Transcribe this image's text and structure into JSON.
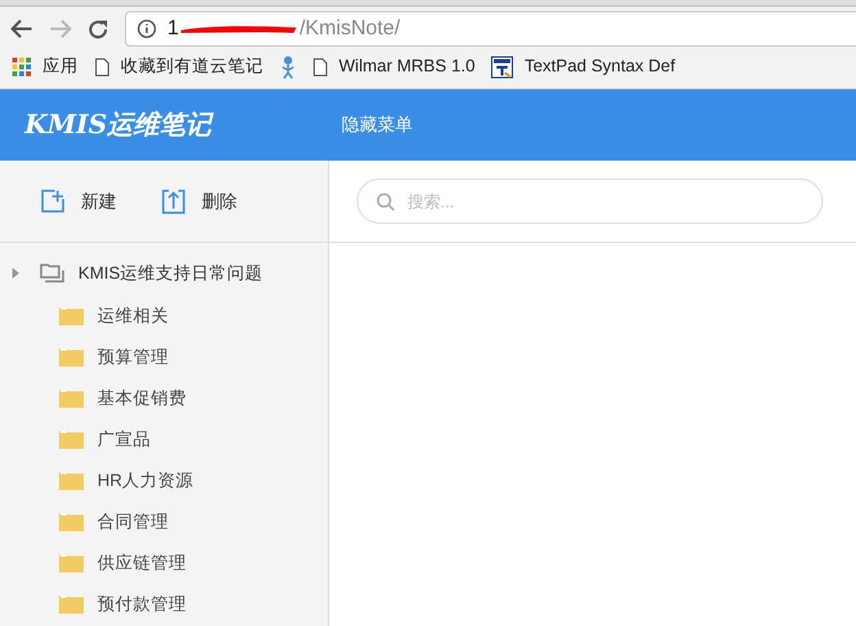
{
  "browser": {
    "url_start": "1",
    "url_rest": "/KmisNote/",
    "bookmarks": [
      {
        "kind": "apps",
        "label": "应用"
      },
      {
        "kind": "page",
        "label": "收藏到有道云笔记"
      },
      {
        "kind": "figure"
      },
      {
        "kind": "page",
        "label": "Wilmar MRBS 1.0"
      },
      {
        "kind": "textpad",
        "label": "TextPad Syntax Def"
      }
    ]
  },
  "header": {
    "title": "KMIS运维笔记",
    "menu_toggle": "隐藏菜单"
  },
  "toolbar": [
    {
      "kind": "new",
      "label": "新建"
    },
    {
      "kind": "delete",
      "label": "删除"
    }
  ],
  "search": {
    "placeholder": "搜索..."
  },
  "tree": [
    {
      "label": "KMIS运维支持日常问题",
      "children": [
        {
          "label": "运维相关"
        },
        {
          "label": "预算管理"
        },
        {
          "label": "基本促销费"
        },
        {
          "label": "广宣品"
        },
        {
          "label": "HR人力资源"
        },
        {
          "label": "合同管理"
        },
        {
          "label": "供应链管理"
        },
        {
          "label": "预付款管理"
        }
      ]
    }
  ]
}
